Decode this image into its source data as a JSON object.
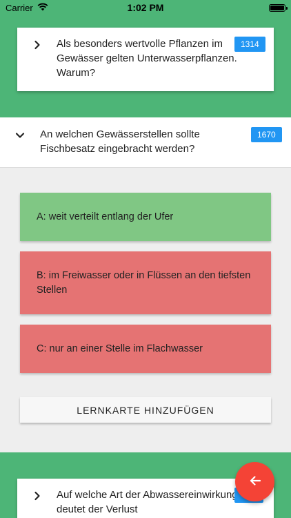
{
  "status_bar": {
    "carrier": "Carrier",
    "time": "1:02 PM"
  },
  "questions": [
    {
      "text": "Als besonders wertvolle Pflanzen im Gewässer gelten Unterwasserpflanzen. Warum?",
      "number": "1314",
      "expanded": false
    },
    {
      "text": "An welchen Gewässerstellen sollte Fischbesatz eingebracht werden?",
      "number": "1670",
      "expanded": true
    },
    {
      "text": "Auf welche Art der Abwassereinwirkung deutet der Verlust",
      "number": "",
      "expanded": false
    }
  ],
  "answers": [
    {
      "label": "A: weit verteilt entlang der Ufer",
      "status": "correct"
    },
    {
      "label": "B: im Freiwasser oder in Flüssen an den tiefsten Stellen",
      "status": "wrong"
    },
    {
      "label": "C: nur an einer Stelle im Flachwasser",
      "status": "wrong"
    }
  ],
  "add_button_label": "LERNKARTE HINZUFÜGEN",
  "colors": {
    "background": "#4db577",
    "correct": "#80c784",
    "wrong": "#e57373",
    "badge": "#2196f3",
    "fab": "#f44336"
  },
  "icons": {
    "collapsed": "chevron-right-icon",
    "expanded": "chevron-down-icon",
    "fab": "arrow-left-icon"
  }
}
